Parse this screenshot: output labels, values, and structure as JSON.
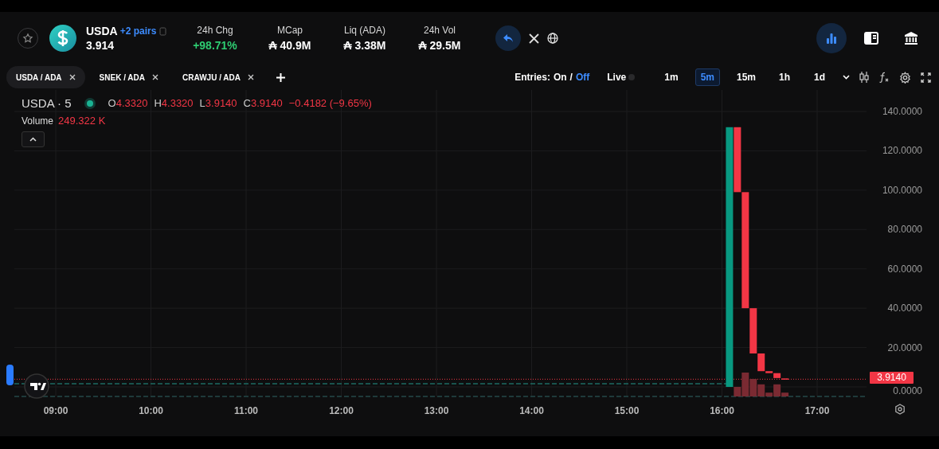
{
  "token": {
    "symbol": "USDA",
    "pairs_link": "+2 pairs",
    "price": "3.914"
  },
  "stats": [
    {
      "label": "24h Chg",
      "value": "+98.71%",
      "kind": "up"
    },
    {
      "label": "MCap",
      "value": "₳ 40.9M",
      "kind": "plain"
    },
    {
      "label": "Liq (ADA)",
      "value": "₳ 3.38M",
      "kind": "plain"
    },
    {
      "label": "24h Vol",
      "value": "₳ 29.5M",
      "kind": "plain"
    }
  ],
  "view_buttons": [
    {
      "kind": "chart",
      "selected": true
    },
    {
      "kind": "panel",
      "selected": false
    },
    {
      "kind": "bank",
      "selected": false
    }
  ],
  "pair_tabs": [
    {
      "label": "USDA / ADA",
      "selected": true
    },
    {
      "label": "SNEK / ADA",
      "selected": false
    },
    {
      "label": "CRAWJU / ADA",
      "selected": false
    }
  ],
  "entries": {
    "label": "Entries:",
    "options": [
      {
        "label": "On",
        "selected": false
      },
      {
        "label": "/",
        "selected": false
      },
      {
        "label": "Off",
        "selected": true
      }
    ]
  },
  "live": {
    "label": "Live",
    "on": false
  },
  "intervals": [
    {
      "label": "1m",
      "selected": false
    },
    {
      "label": "5m",
      "selected": true
    },
    {
      "label": "15m",
      "selected": false
    },
    {
      "label": "1h",
      "selected": false
    },
    {
      "label": "1d",
      "selected": false
    }
  ],
  "legend": {
    "title": "USDA · 5",
    "ohlc": [
      {
        "key": "O",
        "value": "4.3320"
      },
      {
        "key": "H",
        "value": "4.3320"
      },
      {
        "key": "L",
        "value": "3.9140"
      },
      {
        "key": "C",
        "value": "3.9140"
      }
    ],
    "change": "−0.4182 (−9.65%)",
    "volume_label": "Volume",
    "volume_value": "249.322 K"
  },
  "price_label": "3.9140",
  "y_axis_labels": [
    "140.0000",
    "120.0000",
    "100.0000",
    "80.0000",
    "60.0000",
    "40.0000",
    "20.0000",
    "0.0000"
  ],
  "x_axis_labels": [
    "09:00",
    "10:00",
    "11:00",
    "12:00",
    "13:00",
    "14:00",
    "15:00",
    "16:00",
    "17:00"
  ]
}
